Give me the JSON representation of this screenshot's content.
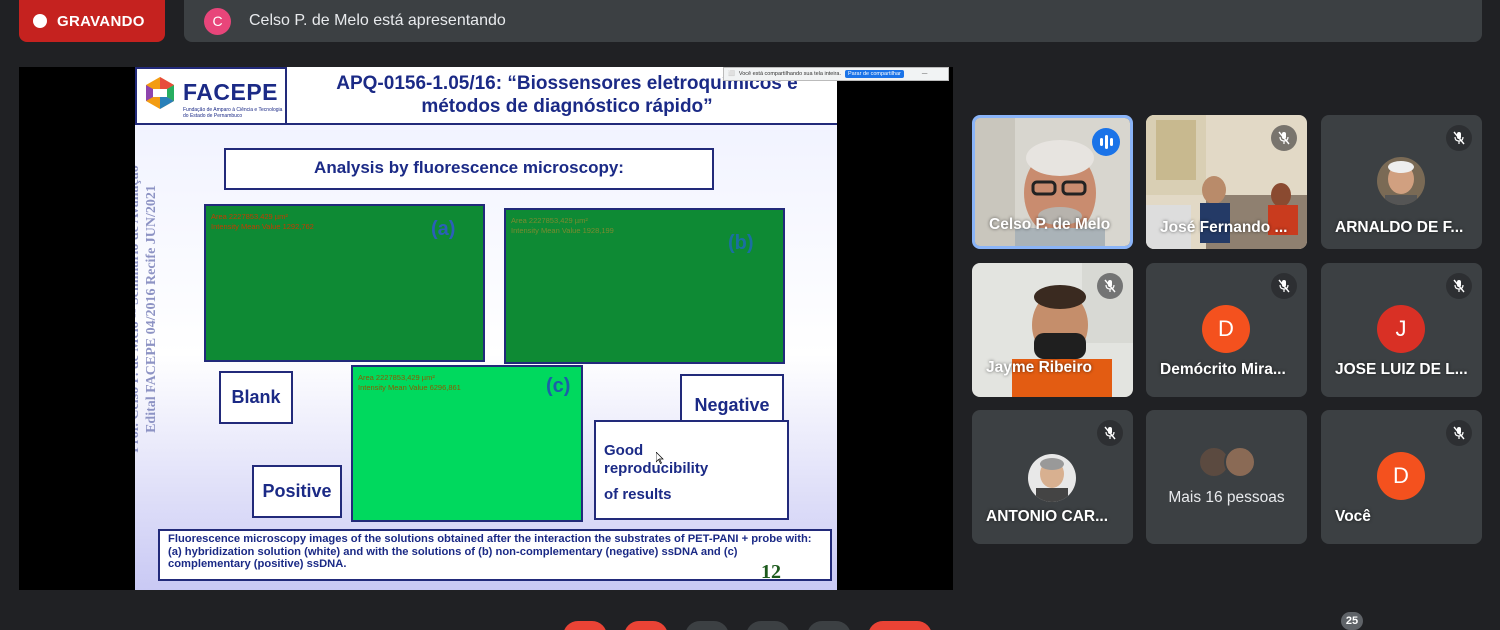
{
  "recording": {
    "label": "GRAVANDO"
  },
  "presenter_bar": {
    "avatar_letter": "C",
    "text": "Celso P. de Melo está apresentando"
  },
  "share_banner": {
    "text": "Você está compartilhando sua tela inteira.",
    "stop_label": "Parar de compartilhar",
    "minimize_label": "—"
  },
  "slide": {
    "logo_text": "FACEPE",
    "logo_subtitle": "Fundação de Amparo à Ciência e Tecnologia do Estado de Pernambuco",
    "title_line1": "APQ-0156-1.05/16: “Biossensores eletroquímicos e",
    "title_line2": "métodos de diagnóstico rápido”",
    "heading": "Analysis by fluorescence microscopy:",
    "image_a": {
      "letter": "(a)",
      "area": "Area 2227853,429 µm²",
      "mean": "Intensity Mean Value 1292,762"
    },
    "image_b": {
      "letter": "(b)",
      "area": "Area 2227853,429 µm²",
      "mean": "Intensity Mean Value 1928,199"
    },
    "image_c": {
      "letter": "(c)",
      "area": "Area 2227853,429 µm²",
      "mean": "Intensity Mean Value 6296,861"
    },
    "label_blank": "Blank",
    "label_positive": "Positive",
    "label_negative": "Negative",
    "good_line1": "Good",
    "good_line2": "reproducibility",
    "good_line3": "of results",
    "caption": "Fluorescence microscopy images of the solutions obtained after the interaction the substrates of PET-PANI + probe with: (a) hybridization solution (white) and with the solutions of (b) non-complementary (negative) ssDNA and (c) complementary (positive) ssDNA.",
    "page_number": "12",
    "vertical_line1": "Prof. Celso P. de Melo -- Seminário de Avaliação",
    "vertical_line2": "Edital FACEPE 04/2016     Recife JUN/2021"
  },
  "participants": [
    {
      "name": "Celso P. de Melo",
      "status": "speaking"
    },
    {
      "name": "José Fernando ...",
      "status": "muted"
    },
    {
      "name": "ARNALDO DE F...",
      "status": "muted"
    },
    {
      "name": "Jayme Ribeiro",
      "status": "muted"
    },
    {
      "name": "Demócrito Mira...",
      "status": "muted",
      "avatar_letter": "D",
      "avatar_color": "#f4511e"
    },
    {
      "name": "JOSE LUIZ DE L...",
      "status": "muted",
      "avatar_letter": "J",
      "avatar_color": "#d93025"
    },
    {
      "name": "ANTONIO CAR...",
      "status": "muted"
    },
    {
      "name": "Mais 16 pessoas",
      "status": "more"
    },
    {
      "name": "Você",
      "status": "muted",
      "avatar_letter": "D",
      "avatar_color": "#f4511e"
    }
  ],
  "participant_count": "25"
}
